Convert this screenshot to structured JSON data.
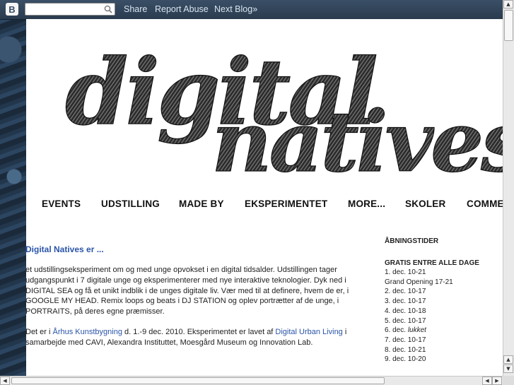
{
  "navbar": {
    "logo": "B",
    "search_placeholder": "",
    "links": [
      "Share",
      "Report Abuse",
      "Next Blog»"
    ]
  },
  "header": {
    "title_image_text": "digital natives"
  },
  "menu": [
    "EVENTS",
    "UDSTILLING",
    "MADE BY",
    "EKSPERIMENTET",
    "MORE...",
    "SKOLER",
    "COMMENTS"
  ],
  "post": {
    "title": "Digital Natives er ...",
    "p1": "et udstillingseksperiment om og med unge opvokset i en digital tidsalder. Udstillingen tager udgangspunkt i 7 digitale unge og eksperimenterer med nye interaktive teknologier. Dyk ned i DIGITAL SEA og få et unikt indblik i de unges digitale liv. Vær med til at definere, hvem de er, i GOOGLE MY HEAD. Remix loops og beats i DJ STATION og oplev portrætter af de unge, i PORTRAITS, på deres egne præmisser.",
    "p2_a": "Det er i ",
    "p2_link1": "Århus Kunstbygning",
    "p2_b": " d. 1.-9 dec. 2010. Eksperimentet er lavet af ",
    "p2_link2": "Digital Urban Living",
    "p2_c": " i samarbejde med CAVI, Alexandra Instituttet, Moesgård Museum og Innovation Lab."
  },
  "sidebar": {
    "title": "ÅBNINGSTIDER",
    "subtitle": "GRATIS ENTRE ALLE DAGE",
    "hours": [
      {
        "day": "1. dec. 10-21",
        "italic": false
      },
      {
        "day": "Grand Opening 17-21",
        "italic": false
      },
      {
        "day": "2. dec. 10-17",
        "italic": false
      },
      {
        "day": "3. dec. 10-17",
        "italic": false
      },
      {
        "day": "4. dec. 10-18",
        "italic": false
      },
      {
        "day": "5. dec. 10-17",
        "italic": false
      },
      {
        "day": "6. dec. ",
        "italic_part": "lukket"
      },
      {
        "day": "7. dec. 10-17",
        "italic": false
      },
      {
        "day": "8. dec. 10-21",
        "italic": false
      },
      {
        "day": "9. dec. 10-20",
        "italic": false
      }
    ]
  },
  "colors": {
    "link": "#2a54a8",
    "navbar": "#3a4f66"
  }
}
